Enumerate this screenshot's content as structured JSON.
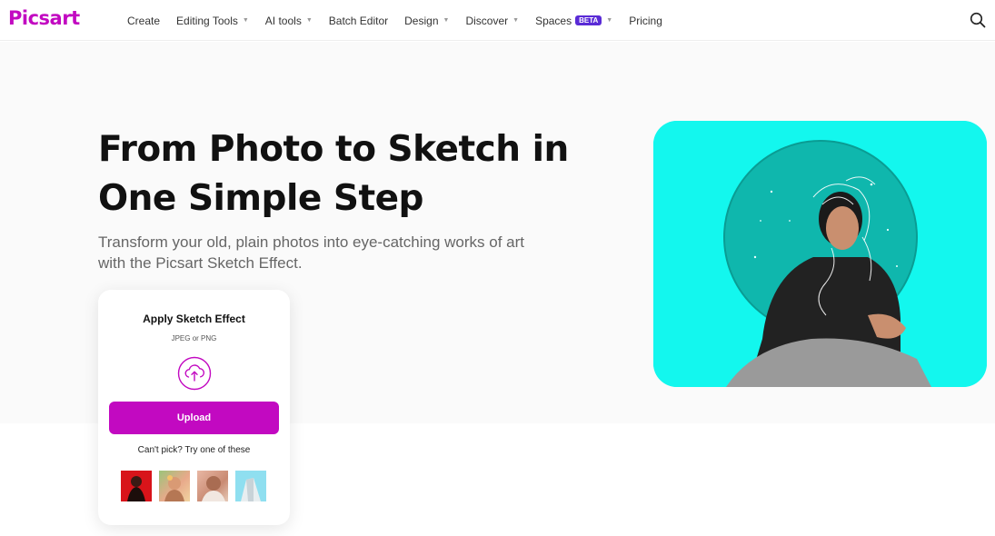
{
  "header": {
    "logo": "Picsart",
    "nav": [
      {
        "label": "Create",
        "dropdown": false
      },
      {
        "label": "Editing Tools",
        "dropdown": true
      },
      {
        "label": "AI tools",
        "dropdown": true
      },
      {
        "label": "Batch Editor",
        "dropdown": false
      },
      {
        "label": "Design",
        "dropdown": true
      },
      {
        "label": "Discover",
        "dropdown": true
      },
      {
        "label": "Spaces",
        "dropdown": true,
        "badge": "BETA"
      },
      {
        "label": "Pricing",
        "dropdown": false
      }
    ],
    "search_icon": "search-icon"
  },
  "hero": {
    "title_line1": "From Photo to Sketch in",
    "title_line2": "One Simple Step",
    "subtitle_line1": "Transform your old, plain photos into eye-catching works of art",
    "subtitle_line2": "with the Picsart Sketch Effect."
  },
  "upload_card": {
    "title": "Apply Sketch Effect",
    "formats": "JPEG or PNG",
    "upload_icon": "cloud-upload-icon",
    "upload_label": "Upload",
    "try_text": "Can't pick? Try one of these"
  },
  "colors": {
    "brand": "#c209c1",
    "beta_badge": "#5a2bd6",
    "hero_image_bg": "#13f7ee"
  }
}
